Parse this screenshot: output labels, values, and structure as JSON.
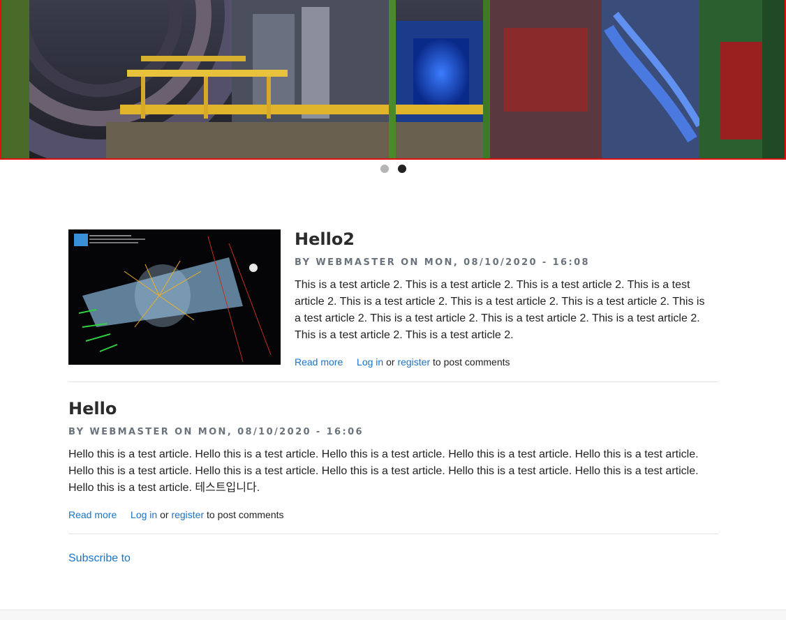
{
  "slider": {
    "dots": [
      "slide 1",
      "slide 2"
    ],
    "active_index": 1
  },
  "articles": [
    {
      "title": "Hello2",
      "meta": "BY WEBMASTER ON MON, 08/10/2020 - 16:08",
      "body": "This is a test article 2. This is a test article 2. This is a test article 2. This is a test article 2. This is a test article 2. This is a test article 2. This is a test article 2. This is a test article 2. This is a test article 2. This is a test article 2. This is a test article 2. This is a test article 2. This is a test article 2.",
      "read_more": "Read more",
      "login": "Log in",
      "or": "or",
      "register": "register",
      "suffix": "to post comments"
    },
    {
      "title": "Hello",
      "meta": "BY WEBMASTER ON MON, 08/10/2020 - 16:06",
      "body": "Hello this is a test article. Hello this is a test article. Hello this is a test article. Hello this is a test article. Hello this is a test article. Hello this is a test article. Hello this is a test article. Hello this is a test article. Hello this is a test article. Hello this is a test article. Hello this is a test article. 테스트입니다.",
      "read_more": "Read more",
      "login": "Log in",
      "or": "or",
      "register": "register",
      "suffix": "to post comments"
    }
  ],
  "subscribe": "Subscribe to",
  "colors": {
    "link": "#1a73c9",
    "slider_border": "#e01010",
    "meta": "#6a737b"
  }
}
